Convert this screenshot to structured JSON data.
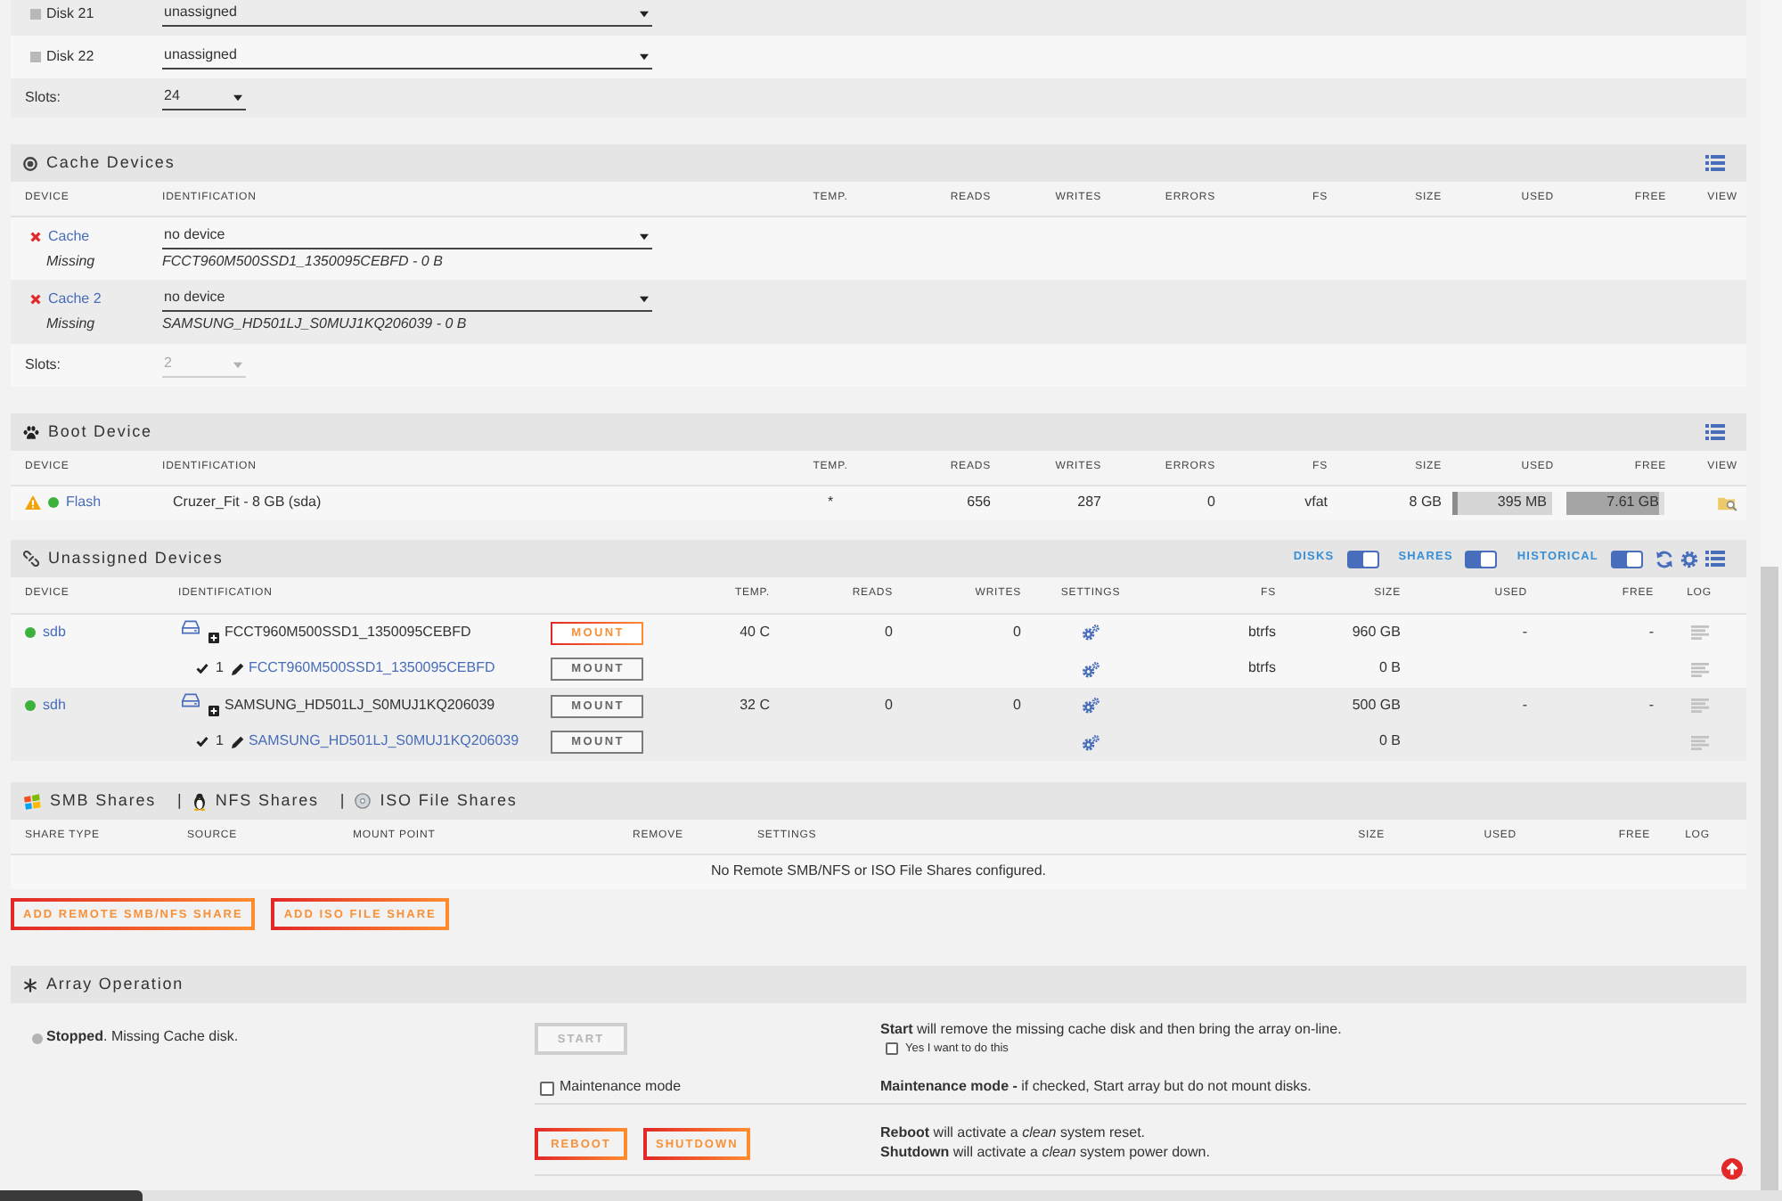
{
  "array_devices": {
    "disks": [
      {
        "name": "Disk 21",
        "assignment": "unassigned"
      },
      {
        "name": "Disk 22",
        "assignment": "unassigned"
      }
    ],
    "slots": {
      "label": "Slots:",
      "value": "24",
      "disabled": false
    }
  },
  "cache_devices": {
    "title": "Cache Devices",
    "columns": [
      "DEVICE",
      "IDENTIFICATION",
      "TEMP.",
      "READS",
      "WRITES",
      "ERRORS",
      "FS",
      "SIZE",
      "USED",
      "FREE",
      "VIEW"
    ],
    "devices": [
      {
        "name": "Cache",
        "missing": true,
        "status": "Missing",
        "assignment": "no device",
        "previous": "FCCT960M500SSD1_1350095CEBFD - 0 B"
      },
      {
        "name": "Cache 2",
        "missing": true,
        "status": "Missing",
        "assignment": "no device",
        "previous": "SAMSUNG_HD501LJ_S0MUJ1KQ206039 - 0 B"
      }
    ],
    "slots": {
      "label": "Slots:",
      "value": "2",
      "disabled": true
    }
  },
  "boot_device": {
    "title": "Boot Device",
    "columns": [
      "DEVICE",
      "IDENTIFICATION",
      "TEMP.",
      "READS",
      "WRITES",
      "ERRORS",
      "FS",
      "SIZE",
      "USED",
      "FREE",
      "VIEW"
    ],
    "devices": [
      {
        "name": "Flash",
        "warning": true,
        "online": true,
        "identification": "Cruzer_Fit - 8 GB (sda)",
        "temp": "*",
        "reads": "656",
        "writes": "287",
        "errors": "0",
        "fs": "vfat",
        "size": "8 GB",
        "used": {
          "text": "395 MB",
          "level": 0.05
        },
        "free": {
          "text": "7.61 GB",
          "level": 0.95
        }
      }
    ]
  },
  "unassigned_devices": {
    "title": "Unassigned Devices",
    "toggles": [
      {
        "label": "DISKS",
        "on": true
      },
      {
        "label": "SHARES",
        "on": true
      },
      {
        "label": "HISTORICAL",
        "on": true
      }
    ],
    "columns": [
      "DEVICE",
      "IDENTIFICATION",
      "TEMP.",
      "READS",
      "WRITES",
      "SETTINGS",
      "FS",
      "SIZE",
      "USED",
      "FREE",
      "LOG"
    ],
    "devices": [
      {
        "device": "sdb",
        "online": true,
        "identification": "FCCT960M500SSD1_1350095CEBFD",
        "mount": {
          "label": "MOUNT",
          "disabled": false
        },
        "temp": "40 C",
        "reads": "0",
        "writes": "0",
        "fs": "btrfs",
        "size": "960 GB",
        "used": "-",
        "free": "-",
        "partitions": [
          {
            "number": "1",
            "name": "FCCT960M500SSD1_1350095CEBFD",
            "mount": {
              "label": "MOUNT",
              "disabled": true
            },
            "fs": "btrfs",
            "size": "0 B"
          }
        ]
      },
      {
        "device": "sdh",
        "online": true,
        "identification": "SAMSUNG_HD501LJ_S0MUJ1KQ206039",
        "mount": {
          "label": "MOUNT",
          "disabled": true
        },
        "temp": "32 C",
        "reads": "0",
        "writes": "0",
        "size": "500 GB",
        "used": "-",
        "free": "-",
        "partitions": [
          {
            "number": "1",
            "name": "SAMSUNG_HD501LJ_S0MUJ1KQ206039",
            "mount": {
              "label": "MOUNT",
              "disabled": true
            },
            "size": "0 B"
          }
        ]
      }
    ]
  },
  "shares": {
    "headings": [
      {
        "kind": "smb",
        "label": "SMB Shares"
      },
      {
        "kind": "nfs",
        "separator": "|",
        "label": "NFS Shares"
      },
      {
        "kind": "iso",
        "separator": "|",
        "label": "ISO File Shares"
      }
    ],
    "columns": [
      "SHARE TYPE",
      "SOURCE",
      "MOUNT POINT",
      "REMOVE",
      "SETTINGS",
      "SIZE",
      "USED",
      "FREE",
      "LOG"
    ],
    "empty_message": "No Remote SMB/NFS or ISO File Shares configured.",
    "buttons": [
      {
        "label": "ADD REMOTE SMB/NFS SHARE",
        "disabled": false
      },
      {
        "label": "ADD ISO FILE SHARE",
        "disabled": false
      }
    ]
  },
  "array_operation": {
    "title": "Array Operation",
    "running": false,
    "status": "**Stopped**. Missing Cache disk.",
    "start": {
      "label": "START",
      "disabled": true,
      "description": "**Start** will remove the missing cache disk and then bring the array on-line.",
      "confirm": {
        "label": "Yes I want to do this",
        "checked": false
      }
    },
    "maintenance": {
      "label": "Maintenance mode",
      "checked": false,
      "description": "**Maintenance mode -** if checked, Start array but do not mount disks."
    },
    "power": {
      "buttons": [
        {
          "label": "REBOOT",
          "disabled": false
        },
        {
          "label": "SHUTDOWN",
          "disabled": false
        }
      ],
      "descriptions": [
        "**Reboot** will activate a *clean* system reset.",
        "**Shutdown** will activate a *clean* system power down."
      ]
    }
  }
}
